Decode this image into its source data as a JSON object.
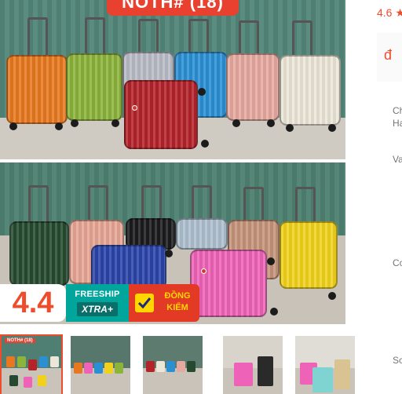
{
  "main_image": {
    "title_banner": "NOTH# (18)"
  },
  "badges": {
    "rating": "4.4",
    "freeship": "FREESHIP",
    "xtra": "XTRA+",
    "verified": "ĐỒNG KIỂM"
  },
  "thumbnails": [
    {
      "tag": "NOTH# (18)",
      "active": true
    },
    {
      "tag": "",
      "active": false
    },
    {
      "tag": "",
      "active": false
    },
    {
      "tag": "",
      "active": false
    },
    {
      "tag": "",
      "active": false
    }
  ],
  "side_panel": {
    "rating": "4.6 ★",
    "price_symbol": "đ",
    "label_1_line_1": "Ch",
    "label_1_line_2": "Ha",
    "label_2": "Va",
    "label_3": "Co",
    "label_4": "Sc"
  },
  "colors": {
    "accent": "#ee4d2d",
    "freeship": "#00a69c",
    "verified": "#e23a25"
  }
}
